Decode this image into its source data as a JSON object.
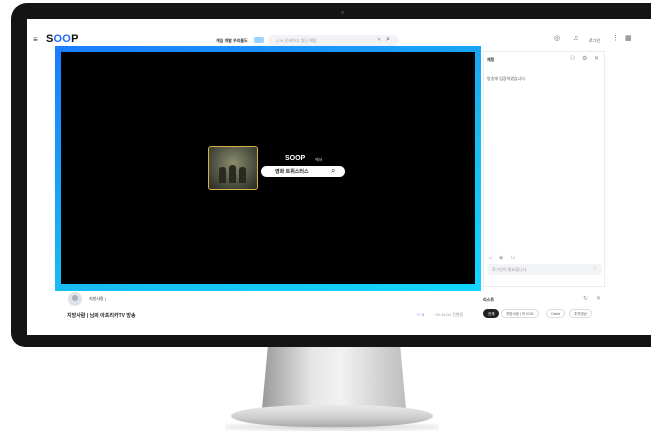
{
  "header": {
    "logo_prefix": "S",
    "logo_oo": "OO",
    "logo_suffix": "P",
    "menu_icon": "hamburger-icon",
    "promo_text": "게임 개발 우리들도 ",
    "search_placeholder": "LCK 준비하고 있단 채팅",
    "search_clear": "✕",
    "login_label": "로그인"
  },
  "player": {
    "logo_text": "SOOP",
    "logo_suffix": "에서",
    "search_text": "영화 트위스터스"
  },
  "chat": {
    "title": "채팅",
    "message": "방송에 입장하였습니다.",
    "input_placeholder": "로그인이 필요합니다."
  },
  "stream": {
    "streamer_name": "지방사람 |",
    "title": "지방사람 | 님의 아프리카TV 방송",
    "viewers": "3",
    "uptime": "· 02:14:00 진행중"
  },
  "list": {
    "title": "리스트",
    "chips": [
      "전체",
      "지방사람 | 의 VOD",
      "Catch",
      "추천영상"
    ]
  },
  "colors": {
    "accent": "#1e6bff",
    "player_gradient_start": "#1a7cff",
    "player_gradient_end": "#12d7ff",
    "bezel": "#141414"
  }
}
